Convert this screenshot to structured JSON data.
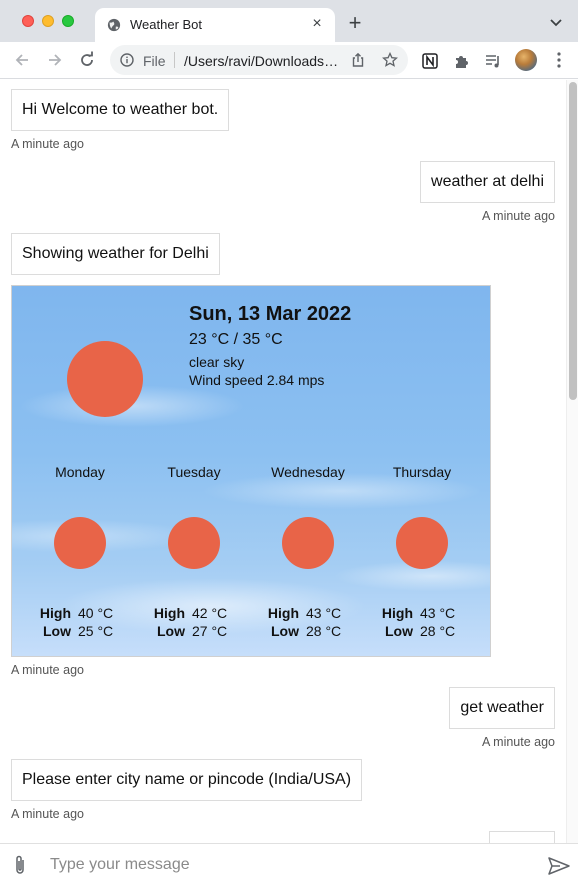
{
  "browser": {
    "tab_title": "Weather Bot",
    "tab_close": "×",
    "new_tab": "+",
    "omnibox": {
      "scheme_label": "File",
      "url": "/Users/ravi/Downloads/index.html"
    }
  },
  "chat": {
    "messages": [
      {
        "from": "bot",
        "text": "Hi Welcome to weather bot.",
        "time": "A minute ago"
      },
      {
        "from": "user",
        "text": "weather at delhi",
        "time": "A minute ago"
      },
      {
        "from": "bot",
        "text": "Showing weather for Delhi"
      },
      {
        "from": "bot",
        "type": "weather_card",
        "time": "A minute ago"
      },
      {
        "from": "user",
        "text": "get weather",
        "time": "A minute ago"
      },
      {
        "from": "bot",
        "text": "Please enter city name or pincode (India/USA)",
        "time": "A minute ago"
      }
    ]
  },
  "weather": {
    "date": "Sun, 13 Mar 2022",
    "temp_range": "23 °C / 35 °C",
    "description": "clear sky",
    "wind": "Wind speed 2.84 mps",
    "high_label": "High",
    "low_label": "Low",
    "forecast": [
      {
        "day": "Monday",
        "high": "40 °C",
        "low": "25 °C"
      },
      {
        "day": "Tuesday",
        "high": "42 °C",
        "low": "27 °C"
      },
      {
        "day": "Wednesday",
        "high": "43 °C",
        "low": "28 °C"
      },
      {
        "day": "Thursday",
        "high": "43 °C",
        "low": "28 °C"
      }
    ],
    "sun_color": "#e86448"
  },
  "composer": {
    "placeholder": "Type your message"
  },
  "colors": {
    "chrome_bg": "#dee1e6",
    "bubble_border": "#dcdcdc",
    "sun": "#e86448"
  }
}
